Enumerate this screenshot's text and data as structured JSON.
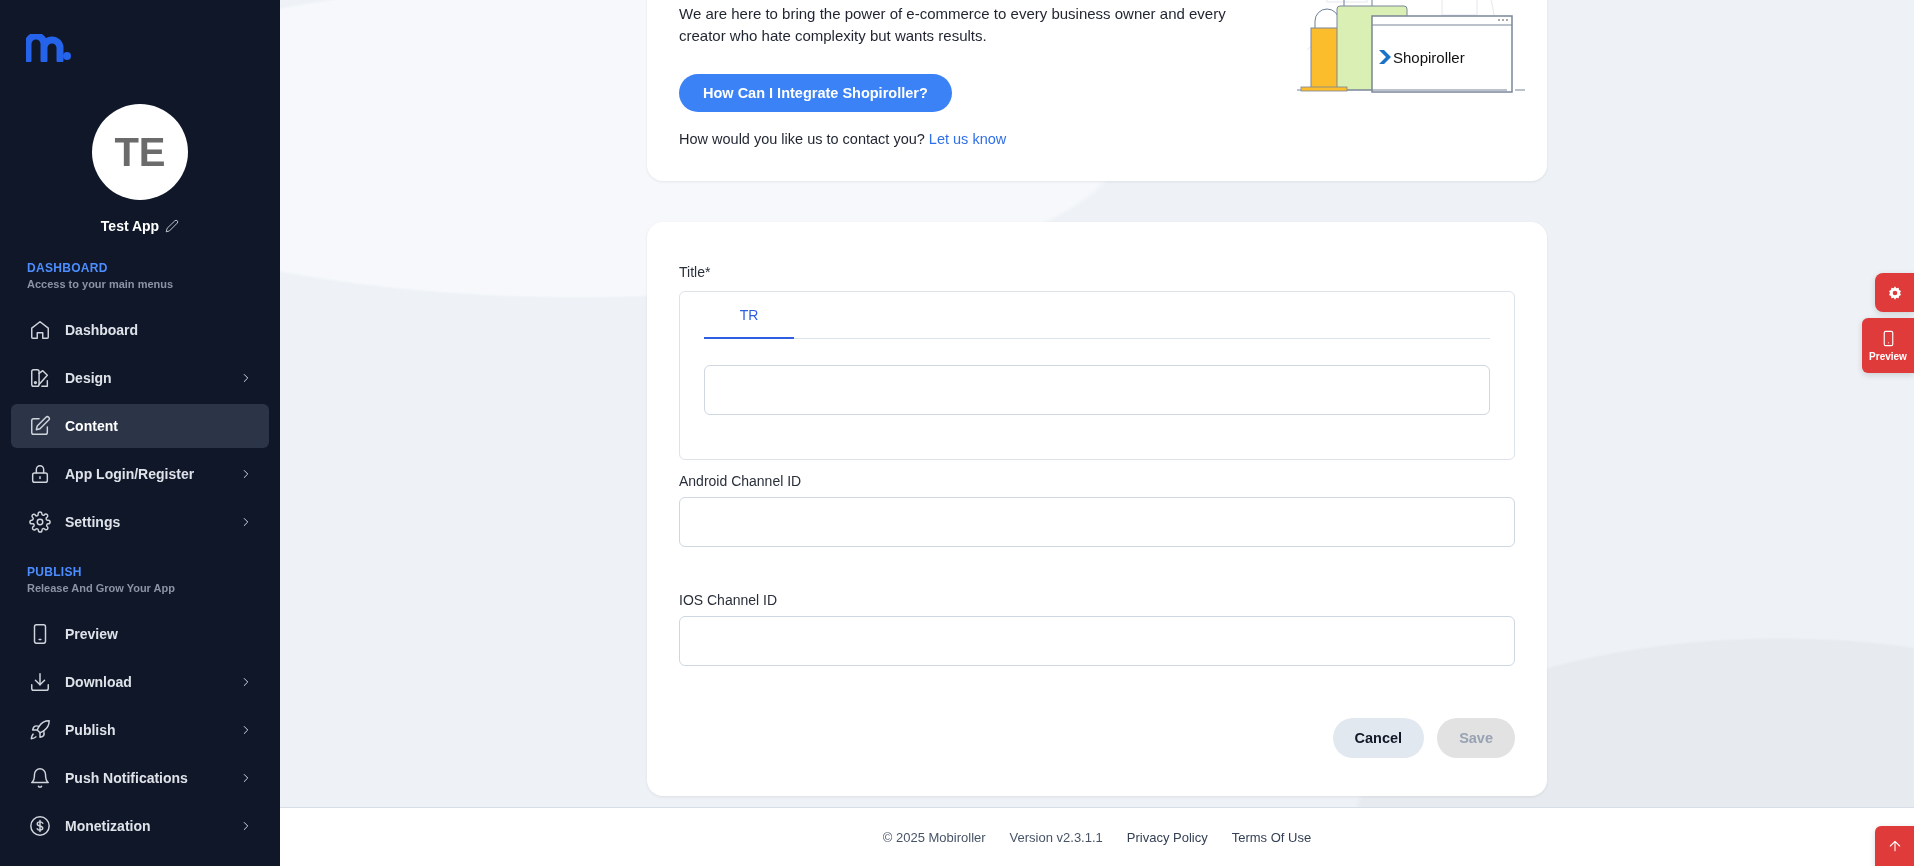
{
  "sidebar": {
    "avatar_initials": "TE",
    "app_name": "Test App",
    "sections": [
      {
        "title": "DASHBOARD",
        "subtitle": "Access to your main menus",
        "items": [
          {
            "label": "Dashboard",
            "expandable": false,
            "selected": false
          },
          {
            "label": "Design",
            "expandable": true,
            "selected": false
          },
          {
            "label": "Content",
            "expandable": false,
            "selected": true
          },
          {
            "label": "App Login/Register",
            "expandable": true,
            "selected": false
          },
          {
            "label": "Settings",
            "expandable": true,
            "selected": false
          }
        ]
      },
      {
        "title": "PUBLISH",
        "subtitle": "Release And Grow Your App",
        "items": [
          {
            "label": "Preview",
            "expandable": false,
            "selected": false
          },
          {
            "label": "Download",
            "expandable": true,
            "selected": false
          },
          {
            "label": "Publish",
            "expandable": true,
            "selected": false
          },
          {
            "label": "Push Notifications",
            "expandable": true,
            "selected": false
          },
          {
            "label": "Monetization",
            "expandable": true,
            "selected": false
          }
        ]
      }
    ]
  },
  "intro": {
    "text": "We are here to bring the power of e-commerce to every business owner and every creator who hate complexity but wants results.",
    "button": "How Can I Integrate Shopiroller?",
    "contact_question": "How would you like us to contact you?",
    "contact_link": "Let us know",
    "illustration_brand": "Shopiroller"
  },
  "form": {
    "title_label": "Title*",
    "language_tabs": [
      {
        "label": "TR",
        "selected": true
      }
    ],
    "fields": [
      {
        "label": "Android Channel ID"
      },
      {
        "label": "IOS Channel ID"
      }
    ],
    "actions": [
      {
        "label": "Cancel",
        "disabled": false
      },
      {
        "label": "Save",
        "disabled": true
      }
    ]
  },
  "floating": {
    "preview_label": "Preview"
  },
  "footer": {
    "items": [
      {
        "text": "© 2025 Mobiroller",
        "kind": "text"
      },
      {
        "text": "Version v2.3.1.1",
        "kind": "text"
      },
      {
        "text": "Privacy Policy",
        "kind": "link"
      },
      {
        "text": "Terms Of Use",
        "kind": "link"
      }
    ]
  }
}
